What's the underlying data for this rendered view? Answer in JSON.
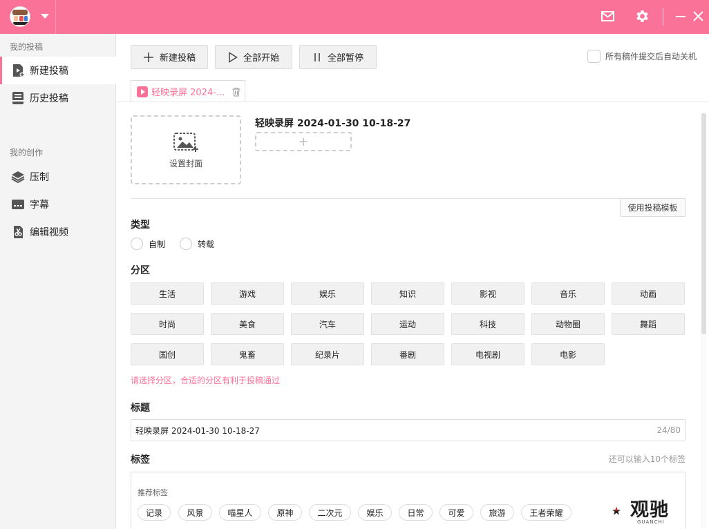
{
  "titlebar": {
    "accent_color": "#fb7299",
    "icons": [
      "mail-icon",
      "gear-icon",
      "minimize-icon",
      "close-icon"
    ]
  },
  "sidebar": {
    "section1_heading": "我的投稿",
    "section2_heading": "我的创作",
    "items": [
      {
        "label": "新建投稿",
        "icon": "new-submission-icon",
        "active": true
      },
      {
        "label": "历史投稿",
        "icon": "history-icon",
        "active": false
      },
      {
        "label": "压制",
        "icon": "layers-icon",
        "active": false
      },
      {
        "label": "字幕",
        "icon": "subtitle-icon",
        "active": false
      },
      {
        "label": "编辑视频",
        "icon": "edit-video-icon",
        "active": false
      }
    ]
  },
  "toolbar": {
    "new_label": "新建投稿",
    "start_all_label": "全部开始",
    "pause_all_label": "全部暂停",
    "auto_shutdown_label": "所有稿件提交后自动关机"
  },
  "file_tab": {
    "label": "轻映录屏 2024-..."
  },
  "cover": {
    "label": "设置封面"
  },
  "video": {
    "title": "轻映录屏 2024-01-30 10-18-27",
    "add_part": "+"
  },
  "template_button": "使用投稿模板",
  "type_section": {
    "label": "类型",
    "options": [
      "自制",
      "转载"
    ]
  },
  "category_section": {
    "label": "分区",
    "rows": [
      [
        "生活",
        "游戏",
        "娱乐",
        "知识",
        "影视",
        "音乐",
        "动画"
      ],
      [
        "时尚",
        "美食",
        "汽车",
        "运动",
        "科技",
        "动物圈",
        "舞蹈"
      ],
      [
        "国创",
        "鬼畜",
        "纪录片",
        "番剧",
        "电视剧",
        "电影"
      ]
    ],
    "hint": "请选择分区，合适的分区有利于投稿通过"
  },
  "title_section": {
    "label": "标题",
    "value": "轻映录屏 2024-01-30 10-18-27",
    "counter": "24/80"
  },
  "tag_section": {
    "label": "标签",
    "remaining": "还可以输入10个标签",
    "recommended_label": "推荐标签",
    "tags": [
      "记录",
      "风景",
      "喵星人",
      "原神",
      "二次元",
      "娱乐",
      "日常",
      "可爱",
      "旅游",
      "王者荣耀"
    ]
  },
  "watermark": {
    "text": "观驰",
    "sub": "GUANCHI"
  }
}
